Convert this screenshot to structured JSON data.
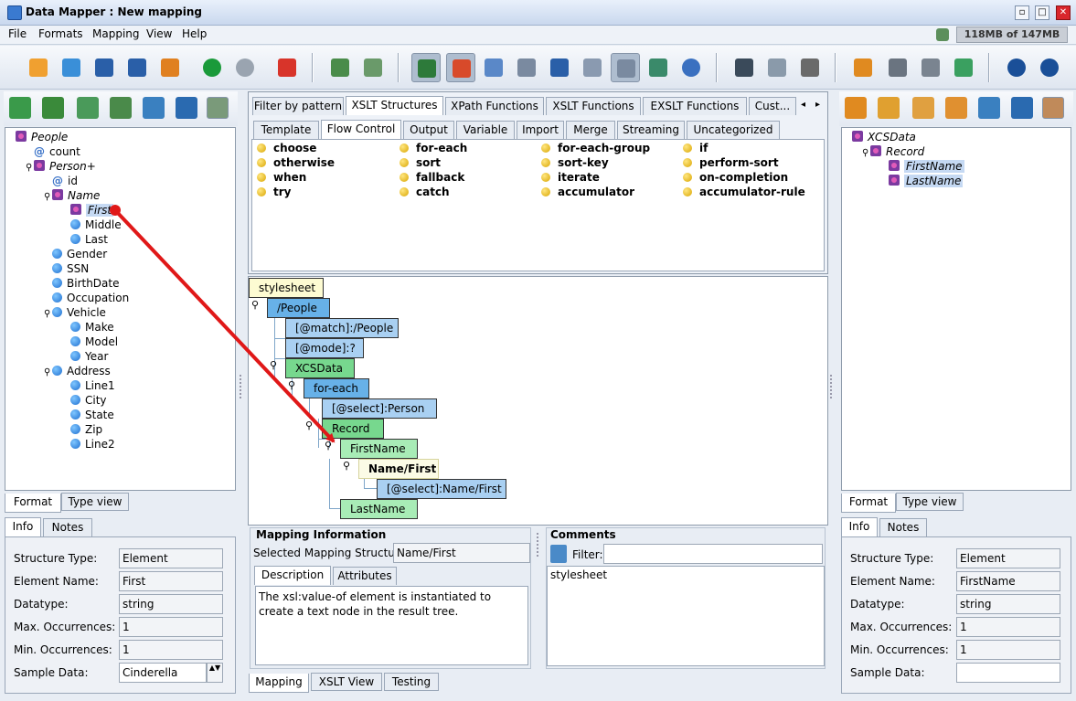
{
  "window": {
    "title": "Data Mapper : New mapping",
    "memory": "118MB of 147MB"
  },
  "menu": [
    "File",
    "Formats",
    "Mapping",
    "View",
    "Help"
  ],
  "source_tree": [
    {
      "label": "People",
      "icon": "complex",
      "italic": true,
      "indent": 0,
      "pin": false
    },
    {
      "label": "count",
      "icon": "attr",
      "italic": false,
      "indent": 1,
      "pin": false
    },
    {
      "label": "Person+",
      "icon": "complex",
      "italic": true,
      "indent": 1,
      "pin": true
    },
    {
      "label": "id",
      "icon": "attr",
      "italic": false,
      "indent": 2,
      "pin": false
    },
    {
      "label": "Name",
      "icon": "complex",
      "italic": true,
      "indent": 2,
      "pin": true
    },
    {
      "label": "First",
      "icon": "complex",
      "italic": true,
      "indent": 3,
      "pin": false,
      "highlight": true
    },
    {
      "label": "Middle",
      "icon": "element",
      "italic": false,
      "indent": 3,
      "pin": false
    },
    {
      "label": "Last",
      "icon": "element",
      "italic": false,
      "indent": 3,
      "pin": false
    },
    {
      "label": "Gender",
      "icon": "element",
      "italic": false,
      "indent": 2,
      "pin": false
    },
    {
      "label": "SSN",
      "icon": "element",
      "italic": false,
      "indent": 2,
      "pin": false
    },
    {
      "label": "BirthDate",
      "icon": "element",
      "italic": false,
      "indent": 2,
      "pin": false
    },
    {
      "label": "Occupation",
      "icon": "element",
      "italic": false,
      "indent": 2,
      "pin": false
    },
    {
      "label": "Vehicle",
      "icon": "element",
      "italic": false,
      "indent": 2,
      "pin": true
    },
    {
      "label": "Make",
      "icon": "element",
      "italic": false,
      "indent": 3,
      "pin": false
    },
    {
      "label": "Model",
      "icon": "element",
      "italic": false,
      "indent": 3,
      "pin": false
    },
    {
      "label": "Year",
      "icon": "element",
      "italic": false,
      "indent": 3,
      "pin": false
    },
    {
      "label": "Address",
      "icon": "element",
      "italic": false,
      "indent": 2,
      "pin": true
    },
    {
      "label": "Line1",
      "icon": "element",
      "italic": false,
      "indent": 3,
      "pin": false
    },
    {
      "label": "City",
      "icon": "element",
      "italic": false,
      "indent": 3,
      "pin": false
    },
    {
      "label": "State",
      "icon": "element",
      "italic": false,
      "indent": 3,
      "pin": false
    },
    {
      "label": "Zip",
      "icon": "element",
      "italic": false,
      "indent": 3,
      "pin": false
    },
    {
      "label": "Line2",
      "icon": "element",
      "italic": false,
      "indent": 3,
      "pin": false
    }
  ],
  "target_tree": [
    {
      "label": "XCSData",
      "italic": true,
      "indent": 0,
      "pin": false
    },
    {
      "label": "Record",
      "italic": true,
      "indent": 1,
      "pin": true
    },
    {
      "label": "FirstName",
      "italic": true,
      "indent": 2,
      "pin": false,
      "highlight": true
    },
    {
      "label": "LastName",
      "italic": true,
      "indent": 2,
      "pin": false,
      "highlight": true
    }
  ],
  "left_bottom_tabs": [
    "Format",
    "Type view"
  ],
  "left_info_tabs": [
    "Info",
    "Notes"
  ],
  "left_info": {
    "labels": [
      "Structure Type:",
      "Element Name:",
      "Datatype:",
      "Max. Occurrences:",
      "Min. Occurrences:",
      "Sample Data:"
    ],
    "values": [
      "Element",
      "First",
      "string",
      "1",
      "1",
      "Cinderella"
    ]
  },
  "right_bottom_tabs": [
    "Format",
    "Type view"
  ],
  "right_info_tabs": [
    "Info",
    "Notes"
  ],
  "right_info": {
    "labels": [
      "Structure Type:",
      "Element Name:",
      "Datatype:",
      "Max. Occurrences:",
      "Min. Occurrences:",
      "Sample Data:"
    ],
    "values": [
      "Element",
      "FirstName",
      "string",
      "1",
      "1",
      ""
    ]
  },
  "top_tabs": [
    "Filter by pattern",
    "XSLT Structures",
    "XPath Functions",
    "XSLT Functions",
    "EXSLT Functions",
    "Cust..."
  ],
  "sub_tabs": [
    "Template",
    "Flow Control",
    "Output",
    "Variable",
    "Import",
    "Merge",
    "Streaming",
    "Uncategorized"
  ],
  "flow_items": [
    [
      "choose",
      "for-each",
      "for-each-group",
      "if"
    ],
    [
      "otherwise",
      "sort",
      "sort-key",
      "perform-sort"
    ],
    [
      "when",
      "fallback",
      "iterate",
      "on-completion"
    ],
    [
      "try",
      "catch",
      "accumulator",
      "accumulator-rule"
    ]
  ],
  "mapping_boxes": [
    "stylesheet",
    "/People",
    "[@match]:/People",
    "[@mode]:?",
    "XCSData",
    "for-each",
    "[@select]:Person",
    "Record",
    "FirstName",
    "Name/First",
    "[@select]:Name/First",
    "LastName"
  ],
  "mapping_info": {
    "header": "Mapping Information",
    "selected_label": "Selected Mapping Structure:",
    "selected_value": "Name/First",
    "tabs": [
      "Description",
      "Attributes"
    ],
    "description": "The xsl:value-of element is instantiated to create a text node in the result tree."
  },
  "comments": {
    "header": "Comments",
    "filter_label": "Filter:",
    "text": "stylesheet"
  },
  "bottom_tabs": [
    "Mapping",
    "XSLT View",
    "Testing"
  ],
  "colors": {
    "mapping_arrow": "#e01818",
    "element_box": "#67b1e8",
    "target_box": "#77d88e"
  }
}
